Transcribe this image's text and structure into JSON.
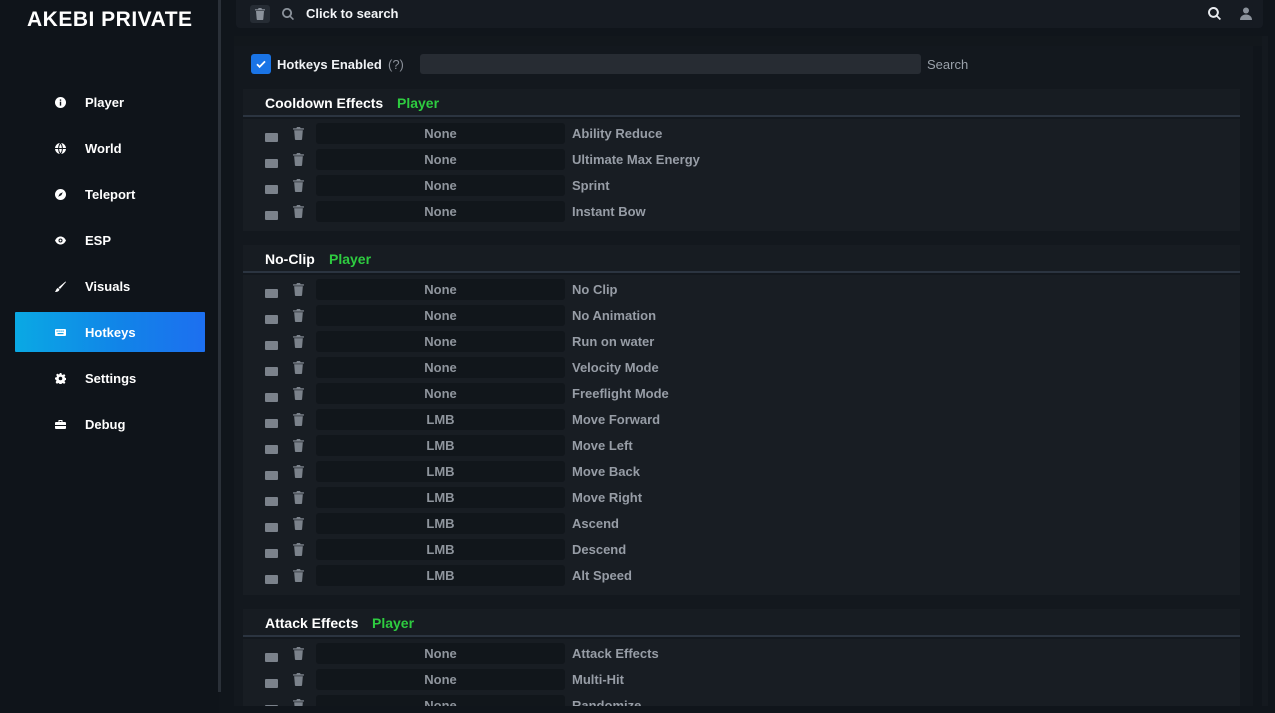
{
  "app": {
    "title": "AKEBI PRIVATE"
  },
  "sidebar": {
    "items": [
      {
        "label": "Player",
        "icon": "info-icon",
        "active": false
      },
      {
        "label": "World",
        "icon": "globe-icon",
        "active": false
      },
      {
        "label": "Teleport",
        "icon": "compass-icon",
        "active": false
      },
      {
        "label": "ESP",
        "icon": "eye-icon",
        "active": false
      },
      {
        "label": "Visuals",
        "icon": "brush-icon",
        "active": false
      },
      {
        "label": "Hotkeys",
        "icon": "keyboard-icon",
        "active": true
      },
      {
        "label": "Settings",
        "icon": "gear-icon",
        "active": false
      },
      {
        "label": "Debug",
        "icon": "toolbox-icon",
        "active": false
      }
    ]
  },
  "topbar": {
    "search_text": "Click to search"
  },
  "hotkeys": {
    "enabled_label": "Hotkeys Enabled",
    "help": "(?)",
    "search_label": "Search",
    "search_value": ""
  },
  "sections": [
    {
      "title": "Cooldown Effects",
      "tag": "Player",
      "rows": [
        {
          "key": "None",
          "name": "Ability Reduce"
        },
        {
          "key": "None",
          "name": "Ultimate Max Energy"
        },
        {
          "key": "None",
          "name": "Sprint"
        },
        {
          "key": "None",
          "name": "Instant Bow"
        }
      ]
    },
    {
      "title": "No-Clip",
      "tag": "Player",
      "rows": [
        {
          "key": "None",
          "name": "No Clip"
        },
        {
          "key": "None",
          "name": "No Animation"
        },
        {
          "key": "None",
          "name": "Run on water"
        },
        {
          "key": "None",
          "name": "Velocity Mode"
        },
        {
          "key": "None",
          "name": "Freeflight Mode"
        },
        {
          "key": "LMB",
          "name": "Move Forward"
        },
        {
          "key": "LMB",
          "name": "Move Left"
        },
        {
          "key": "LMB",
          "name": "Move Back"
        },
        {
          "key": "LMB",
          "name": "Move Right"
        },
        {
          "key": "LMB",
          "name": "Ascend"
        },
        {
          "key": "LMB",
          "name": "Descend"
        },
        {
          "key": "LMB",
          "name": "Alt Speed"
        }
      ]
    },
    {
      "title": "Attack Effects",
      "tag": "Player",
      "rows": [
        {
          "key": "None",
          "name": "Attack Effects"
        },
        {
          "key": "None",
          "name": "Multi-Hit"
        },
        {
          "key": "None",
          "name": "Randomize"
        }
      ]
    }
  ],
  "colors": {
    "accent": "#1a74e6",
    "tag_green": "#2ecc40",
    "active_start": "#0aa9e4",
    "active_end": "#1d6ff0"
  }
}
